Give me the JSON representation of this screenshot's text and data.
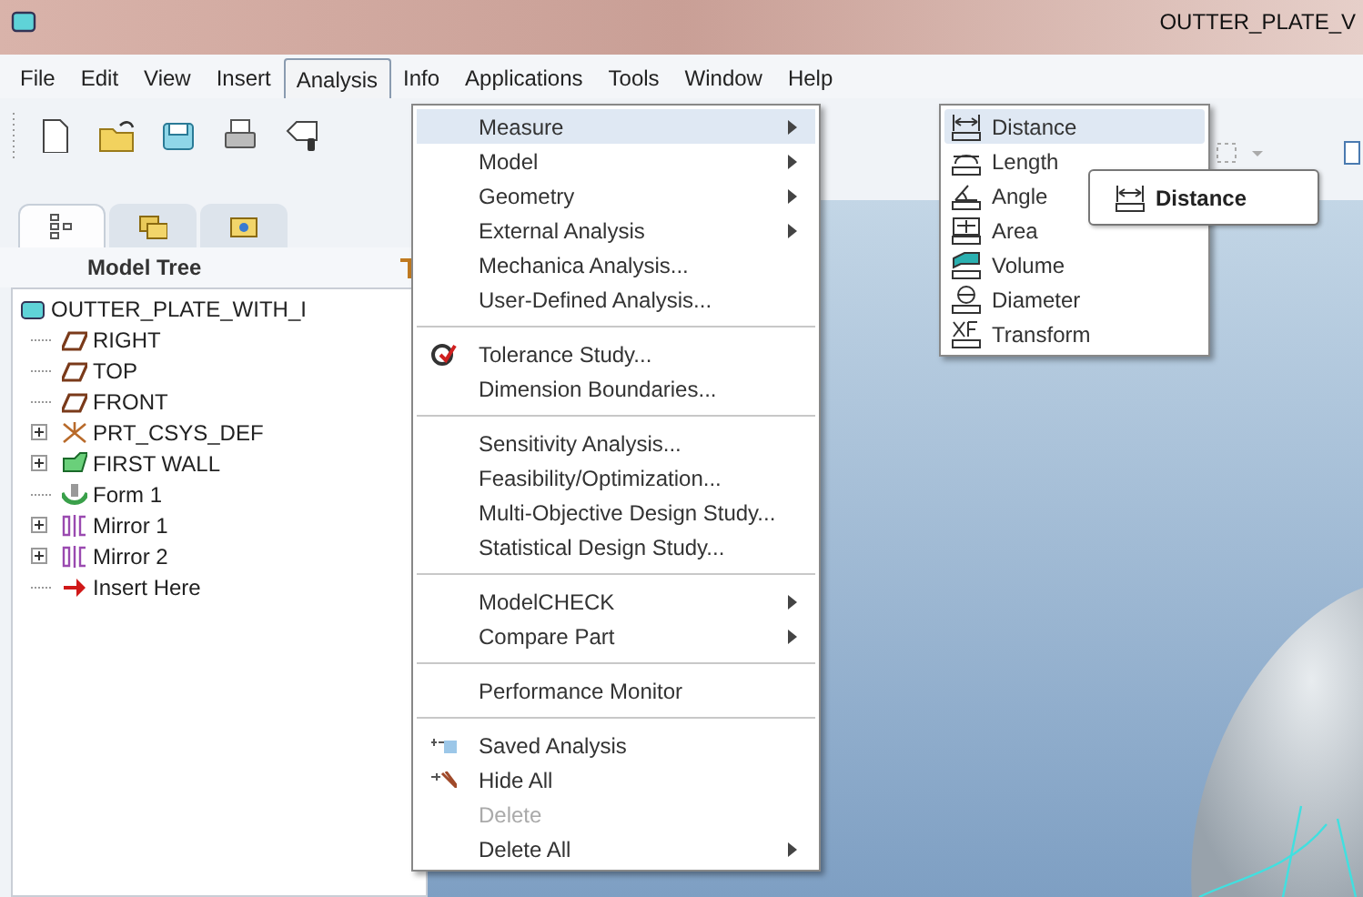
{
  "window": {
    "title": "OUTTER_PLATE_V"
  },
  "menu_bar": [
    {
      "label": "File",
      "selected": false
    },
    {
      "label": "Edit",
      "selected": false
    },
    {
      "label": "View",
      "selected": false
    },
    {
      "label": "Insert",
      "selected": false
    },
    {
      "label": "Analysis",
      "selected": true
    },
    {
      "label": "Info",
      "selected": false
    },
    {
      "label": "Applications",
      "selected": false
    },
    {
      "label": "Tools",
      "selected": false
    },
    {
      "label": "Window",
      "selected": false
    },
    {
      "label": "Help",
      "selected": false
    }
  ],
  "panel_tabs": [
    {
      "kind": "tree",
      "selected": true
    },
    {
      "kind": "folders",
      "selected": false
    },
    {
      "kind": "favorites",
      "selected": false
    }
  ],
  "model_tree": {
    "title": "Model Tree",
    "items": [
      {
        "label": "OUTTER_PLATE_WITH_I",
        "kind": "part",
        "expandable": false,
        "children": [
          {
            "label": "RIGHT",
            "kind": "plane",
            "expandable": false
          },
          {
            "label": "TOP",
            "kind": "plane",
            "expandable": false
          },
          {
            "label": "FRONT",
            "kind": "plane",
            "expandable": false
          },
          {
            "label": "PRT_CSYS_DEF",
            "kind": "csys",
            "expandable": true,
            "expanded": false
          },
          {
            "label": "FIRST WALL",
            "kind": "wall",
            "expandable": true,
            "expanded": false
          },
          {
            "label": "Form 1",
            "kind": "form",
            "expandable": false
          },
          {
            "label": "Mirror 1",
            "kind": "mirror",
            "expandable": true,
            "expanded": false
          },
          {
            "label": "Mirror 2",
            "kind": "mirror",
            "expandable": true,
            "expanded": false
          },
          {
            "label": "Insert Here",
            "kind": "insert",
            "expandable": false
          }
        ]
      }
    ]
  },
  "analysis_menu": [
    [
      {
        "label": "Measure",
        "submenu": true,
        "selected": true,
        "disabled": false
      },
      {
        "label": "Model",
        "submenu": true,
        "selected": false,
        "disabled": false
      },
      {
        "label": "Geometry",
        "submenu": true,
        "selected": false,
        "disabled": false
      },
      {
        "label": "External Analysis",
        "submenu": true,
        "selected": false,
        "disabled": false
      },
      {
        "label": "Mechanica Analysis...",
        "submenu": false,
        "selected": false,
        "disabled": false
      },
      {
        "label": "User-Defined Analysis...",
        "submenu": false,
        "selected": false,
        "disabled": false
      }
    ],
    [
      {
        "label": "Tolerance Study...",
        "submenu": false,
        "selected": false,
        "disabled": false,
        "kind": "tolerance"
      },
      {
        "label": "Dimension Boundaries...",
        "submenu": false,
        "selected": false,
        "disabled": false
      }
    ],
    [
      {
        "label": "Sensitivity Analysis...",
        "submenu": false,
        "selected": false,
        "disabled": false
      },
      {
        "label": "Feasibility/Optimization...",
        "submenu": false,
        "selected": false,
        "disabled": false
      },
      {
        "label": "Multi-Objective Design Study...",
        "submenu": false,
        "selected": false,
        "disabled": false
      },
      {
        "label": "Statistical Design Study...",
        "submenu": false,
        "selected": false,
        "disabled": false
      }
    ],
    [
      {
        "label": "ModelCHECK",
        "submenu": true,
        "selected": false,
        "disabled": false
      },
      {
        "label": "Compare Part",
        "submenu": true,
        "selected": false,
        "disabled": false
      }
    ],
    [
      {
        "label": "Performance Monitor",
        "submenu": false,
        "selected": false,
        "disabled": false
      }
    ],
    [
      {
        "label": "Saved Analysis",
        "submenu": false,
        "selected": false,
        "disabled": false,
        "kind": "saved"
      },
      {
        "label": "Hide All",
        "submenu": false,
        "selected": false,
        "disabled": false,
        "kind": "hide"
      },
      {
        "label": "Delete",
        "submenu": false,
        "selected": false,
        "disabled": true
      },
      {
        "label": "Delete All",
        "submenu": true,
        "selected": false,
        "disabled": false
      }
    ]
  ],
  "measure_submenu": [
    {
      "label": "Distance",
      "kind": "distance",
      "selected": true
    },
    {
      "label": "Length",
      "kind": "length",
      "selected": false
    },
    {
      "label": "Angle",
      "kind": "angle",
      "selected": false
    },
    {
      "label": "Area",
      "kind": "area",
      "selected": false
    },
    {
      "label": "Volume",
      "kind": "volume",
      "selected": false
    },
    {
      "label": "Diameter",
      "kind": "diameter",
      "selected": false
    },
    {
      "label": "Transform",
      "kind": "transform",
      "selected": false
    }
  ],
  "tooltip": {
    "label": "Distance",
    "kind": "distance"
  }
}
